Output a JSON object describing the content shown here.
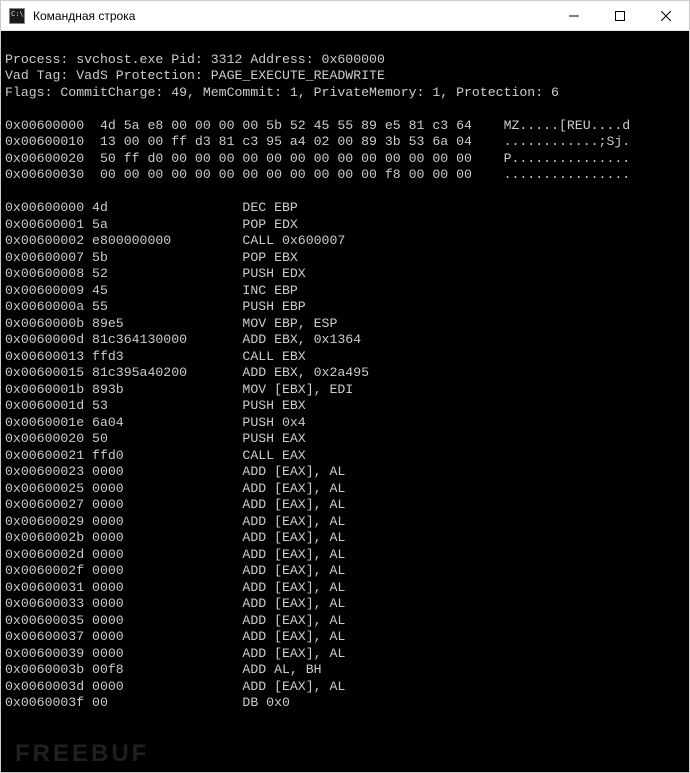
{
  "window": {
    "title": "Командная строка"
  },
  "watermark": "FREEBUF",
  "header": {
    "line1": "Process: svchost.exe Pid: 3312 Address: 0x600000",
    "line2": "Vad Tag: VadS Protection: PAGE_EXECUTE_READWRITE",
    "line3": "Flags: CommitCharge: 49, MemCommit: 1, PrivateMemory: 1, Protection: 6"
  },
  "hexdump": [
    {
      "addr": "0x00600000",
      "hex": "4d 5a e8 00 00 00 00 5b 52 45 55 89 e5 81 c3 64",
      "ascii": "MZ.....[REU....d"
    },
    {
      "addr": "0x00600010",
      "hex": "13 00 00 ff d3 81 c3 95 a4 02 00 89 3b 53 6a 04",
      "ascii": "............;Sj."
    },
    {
      "addr": "0x00600020",
      "hex": "50 ff d0 00 00 00 00 00 00 00 00 00 00 00 00 00",
      "ascii": "P..............."
    },
    {
      "addr": "0x00600030",
      "hex": "00 00 00 00 00 00 00 00 00 00 00 00 f8 00 00 00",
      "ascii": "................"
    }
  ],
  "disasm": [
    {
      "addr": "0x00600000",
      "bytes": "4d",
      "instr": "DEC EBP"
    },
    {
      "addr": "0x00600001",
      "bytes": "5a",
      "instr": "POP EDX"
    },
    {
      "addr": "0x00600002",
      "bytes": "e800000000",
      "instr": "CALL 0x600007"
    },
    {
      "addr": "0x00600007",
      "bytes": "5b",
      "instr": "POP EBX"
    },
    {
      "addr": "0x00600008",
      "bytes": "52",
      "instr": "PUSH EDX"
    },
    {
      "addr": "0x00600009",
      "bytes": "45",
      "instr": "INC EBP"
    },
    {
      "addr": "0x0060000a",
      "bytes": "55",
      "instr": "PUSH EBP"
    },
    {
      "addr": "0x0060000b",
      "bytes": "89e5",
      "instr": "MOV EBP, ESP"
    },
    {
      "addr": "0x0060000d",
      "bytes": "81c364130000",
      "instr": "ADD EBX, 0x1364"
    },
    {
      "addr": "0x00600013",
      "bytes": "ffd3",
      "instr": "CALL EBX"
    },
    {
      "addr": "0x00600015",
      "bytes": "81c395a40200",
      "instr": "ADD EBX, 0x2a495"
    },
    {
      "addr": "0x0060001b",
      "bytes": "893b",
      "instr": "MOV [EBX], EDI"
    },
    {
      "addr": "0x0060001d",
      "bytes": "53",
      "instr": "PUSH EBX"
    },
    {
      "addr": "0x0060001e",
      "bytes": "6a04",
      "instr": "PUSH 0x4"
    },
    {
      "addr": "0x00600020",
      "bytes": "50",
      "instr": "PUSH EAX"
    },
    {
      "addr": "0x00600021",
      "bytes": "ffd0",
      "instr": "CALL EAX"
    },
    {
      "addr": "0x00600023",
      "bytes": "0000",
      "instr": "ADD [EAX], AL"
    },
    {
      "addr": "0x00600025",
      "bytes": "0000",
      "instr": "ADD [EAX], AL"
    },
    {
      "addr": "0x00600027",
      "bytes": "0000",
      "instr": "ADD [EAX], AL"
    },
    {
      "addr": "0x00600029",
      "bytes": "0000",
      "instr": "ADD [EAX], AL"
    },
    {
      "addr": "0x0060002b",
      "bytes": "0000",
      "instr": "ADD [EAX], AL"
    },
    {
      "addr": "0x0060002d",
      "bytes": "0000",
      "instr": "ADD [EAX], AL"
    },
    {
      "addr": "0x0060002f",
      "bytes": "0000",
      "instr": "ADD [EAX], AL"
    },
    {
      "addr": "0x00600031",
      "bytes": "0000",
      "instr": "ADD [EAX], AL"
    },
    {
      "addr": "0x00600033",
      "bytes": "0000",
      "instr": "ADD [EAX], AL"
    },
    {
      "addr": "0x00600035",
      "bytes": "0000",
      "instr": "ADD [EAX], AL"
    },
    {
      "addr": "0x00600037",
      "bytes": "0000",
      "instr": "ADD [EAX], AL"
    },
    {
      "addr": "0x00600039",
      "bytes": "0000",
      "instr": "ADD [EAX], AL"
    },
    {
      "addr": "0x0060003b",
      "bytes": "00f8",
      "instr": "ADD AL, BH"
    },
    {
      "addr": "0x0060003d",
      "bytes": "0000",
      "instr": "ADD [EAX], AL"
    },
    {
      "addr": "0x0060003f",
      "bytes": "00",
      "instr": "DB 0x0"
    }
  ]
}
